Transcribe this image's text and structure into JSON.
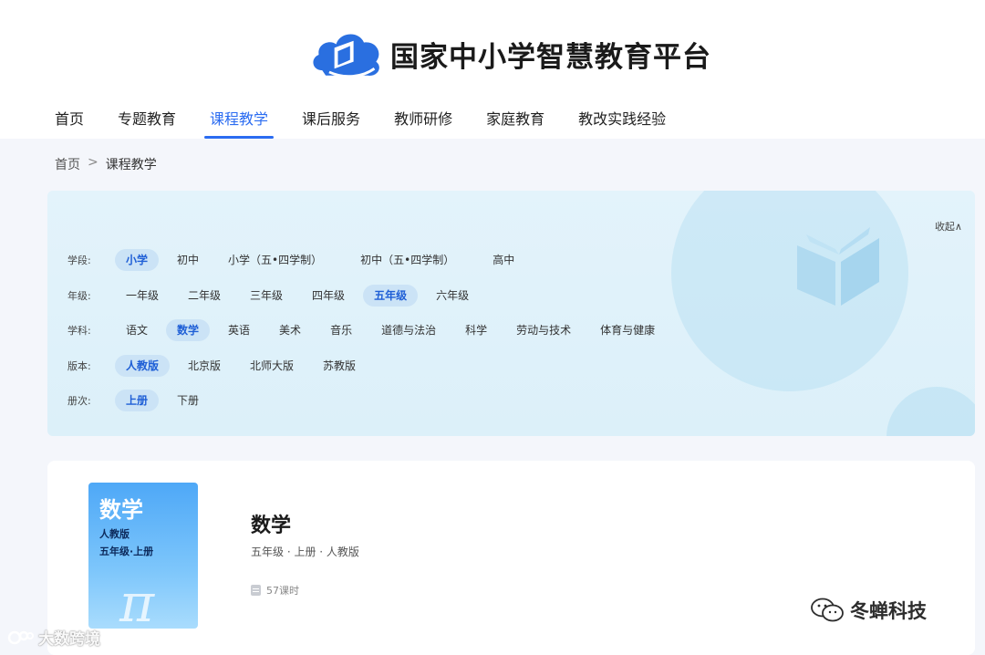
{
  "header": {
    "site_title": "国家中小学智慧教育平台",
    "nav": [
      {
        "label": "首页",
        "active": false
      },
      {
        "label": "专题教育",
        "active": false
      },
      {
        "label": "课程教学",
        "active": true
      },
      {
        "label": "课后服务",
        "active": false
      },
      {
        "label": "教师研修",
        "active": false
      },
      {
        "label": "家庭教育",
        "active": false
      },
      {
        "label": "教改实践经验",
        "active": false
      }
    ]
  },
  "breadcrumb": {
    "home": "首页",
    "separator": ">",
    "current": "课程教学"
  },
  "filters": {
    "collapse_label": "收起∧",
    "rows": [
      {
        "label": "学段:",
        "options": [
          "小学",
          "初中",
          "小学（五•四学制）",
          "初中（五•四学制）",
          "高中"
        ],
        "selected": "小学"
      },
      {
        "label": "年级:",
        "options": [
          "一年级",
          "二年级",
          "三年级",
          "四年级",
          "五年级",
          "六年级"
        ],
        "selected": "五年级"
      },
      {
        "label": "学科:",
        "options": [
          "语文",
          "数学",
          "英语",
          "美术",
          "音乐",
          "道德与法治",
          "科学",
          "劳动与技术",
          "体育与健康"
        ],
        "selected": "数学"
      },
      {
        "label": "版本:",
        "options": [
          "人教版",
          "北京版",
          "北师大版",
          "苏教版"
        ],
        "selected": "人教版"
      },
      {
        "label": "册次:",
        "options": [
          "上册",
          "下册"
        ],
        "selected": "上册"
      }
    ]
  },
  "course": {
    "cover_title": "数学",
    "cover_line1": "人教版",
    "cover_line2": "五年级·上册",
    "cover_symbol": "π",
    "title": "数学",
    "meta": "五年级 · 上册 · 人教版",
    "lessons": "57课时"
  },
  "watermarks": {
    "left": "大数跨境",
    "right": "冬蝉科技"
  },
  "colors": {
    "accent": "#2b6cf1",
    "chip_selected_bg": "#cbe3f6",
    "logo_blue": "#2a6fe0"
  }
}
